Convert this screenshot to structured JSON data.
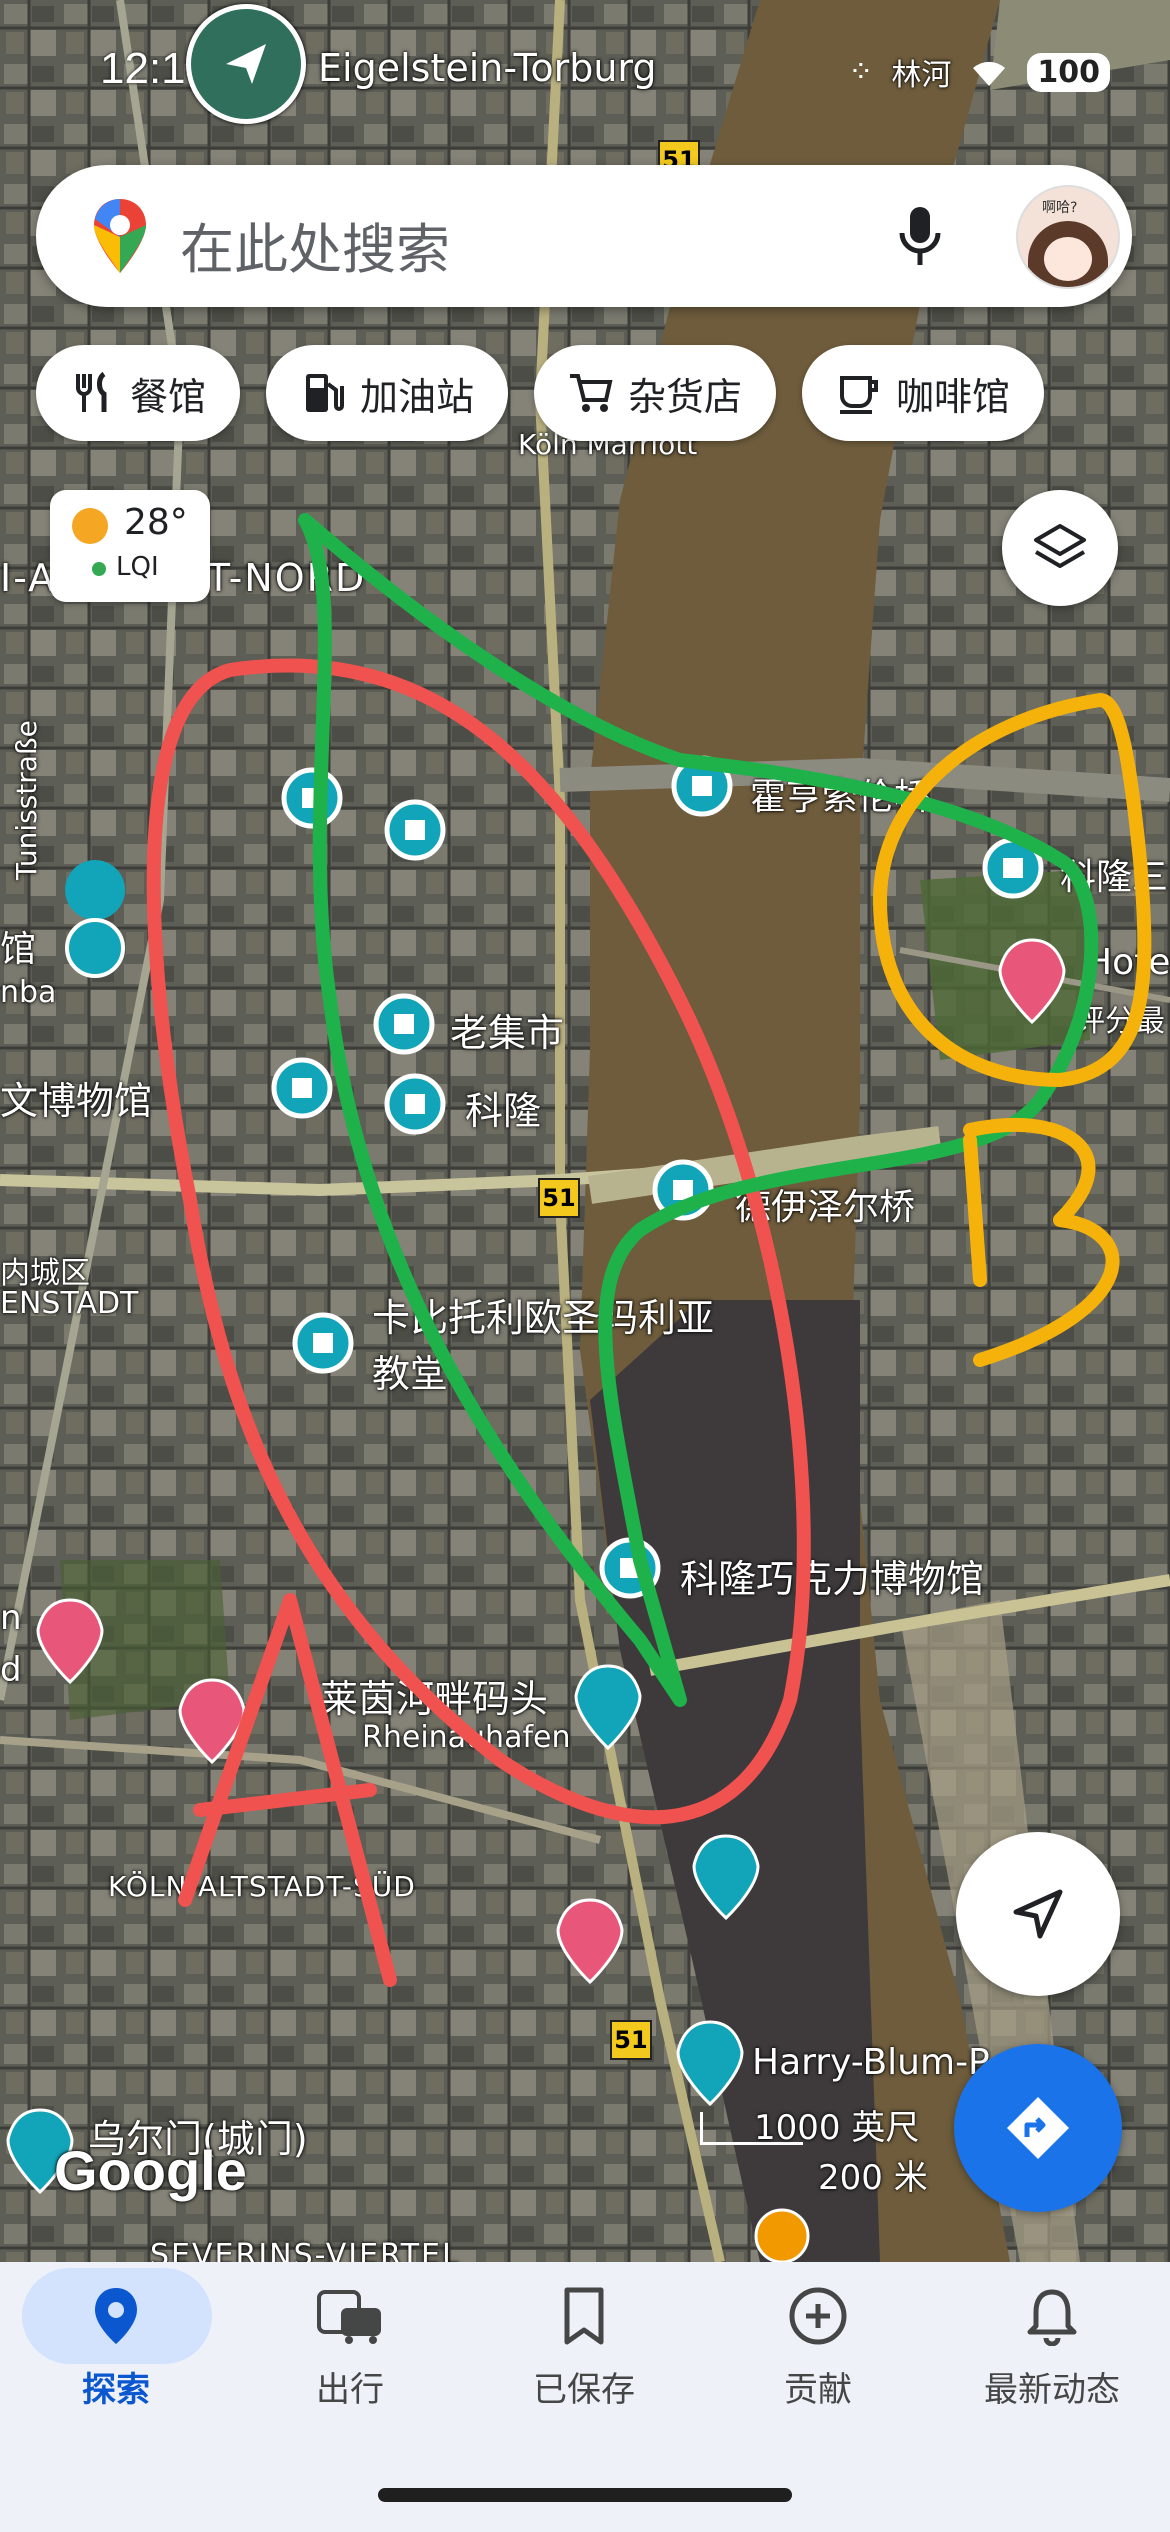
{
  "status_bar": {
    "time": "12:14",
    "location_badge": "Eigelstein-Torburg",
    "carrier_text": "林河",
    "battery": "100"
  },
  "search": {
    "placeholder": "在此处搜索",
    "avatar_text": "啊哈?"
  },
  "chips": [
    {
      "label": "餐馆",
      "icon": "restaurant-icon"
    },
    {
      "label": "加油站",
      "icon": "gas-station-icon"
    },
    {
      "label": "杂货店",
      "icon": "cart-icon"
    },
    {
      "label": "咖啡馆",
      "icon": "coffee-icon"
    }
  ],
  "weather": {
    "temperature": "28°",
    "aqi": "LQI"
  },
  "map_labels": {
    "marriott": "Köln Marriott",
    "district_nord": "I-ALTSTADT-NORD",
    "tunisstrasse": "Tunisstraße",
    "bridge1": "霍亨索伦桥",
    "koeln_right": "科隆三",
    "hotel_right": "Hote",
    "hotel_right_sub": "评分最",
    "museum_left": "馆",
    "museum_left2": "nba",
    "museum_left3": "文博物馆",
    "old_market": "老集市",
    "cologne": "科隆",
    "bridge2": "德伊泽尔桥",
    "road_51a": "51",
    "road_51b": "51",
    "road_51c": "51",
    "inner_city": "内城区",
    "enstadt": "ENSTADT",
    "church": "卡比托利欧圣玛利亚教堂",
    "chocolate_museum": "科隆巧克力博物馆",
    "rheinauhafen_cn": "莱茵河畔码头",
    "rheinauhafen": "Rheinauhafen",
    "altstadt_sud": "KÖLN-ALTSTADT-SÜD",
    "harry_blum": "Harry-Blum-P",
    "gate": "乌尔门(城门)",
    "severins": "SEVERINS-VIERTEL",
    "left_n": "n",
    "left_d": "d"
  },
  "scale": {
    "imperial": "1000 英尺",
    "metric": "200 米"
  },
  "google_logo": "Google",
  "annotations": {
    "letter_a": "A",
    "letter_b": "B"
  },
  "bottom_nav": [
    {
      "label": "探索",
      "icon": "pin-icon",
      "active": true
    },
    {
      "label": "出行",
      "icon": "commute-icon",
      "active": false
    },
    {
      "label": "已保存",
      "icon": "bookmark-icon",
      "active": false
    },
    {
      "label": "贡献",
      "icon": "add-circle-icon",
      "active": false
    },
    {
      "label": "最新动态",
      "icon": "bell-icon",
      "active": false
    }
  ],
  "colors": {
    "accent_blue": "#1a73e8",
    "poi_teal": "#12a4b8",
    "hotel_pink": "#e8577a",
    "annotation_red": "#f0524f",
    "annotation_green": "#1fb24a",
    "annotation_yellow": "#f5b20a"
  }
}
